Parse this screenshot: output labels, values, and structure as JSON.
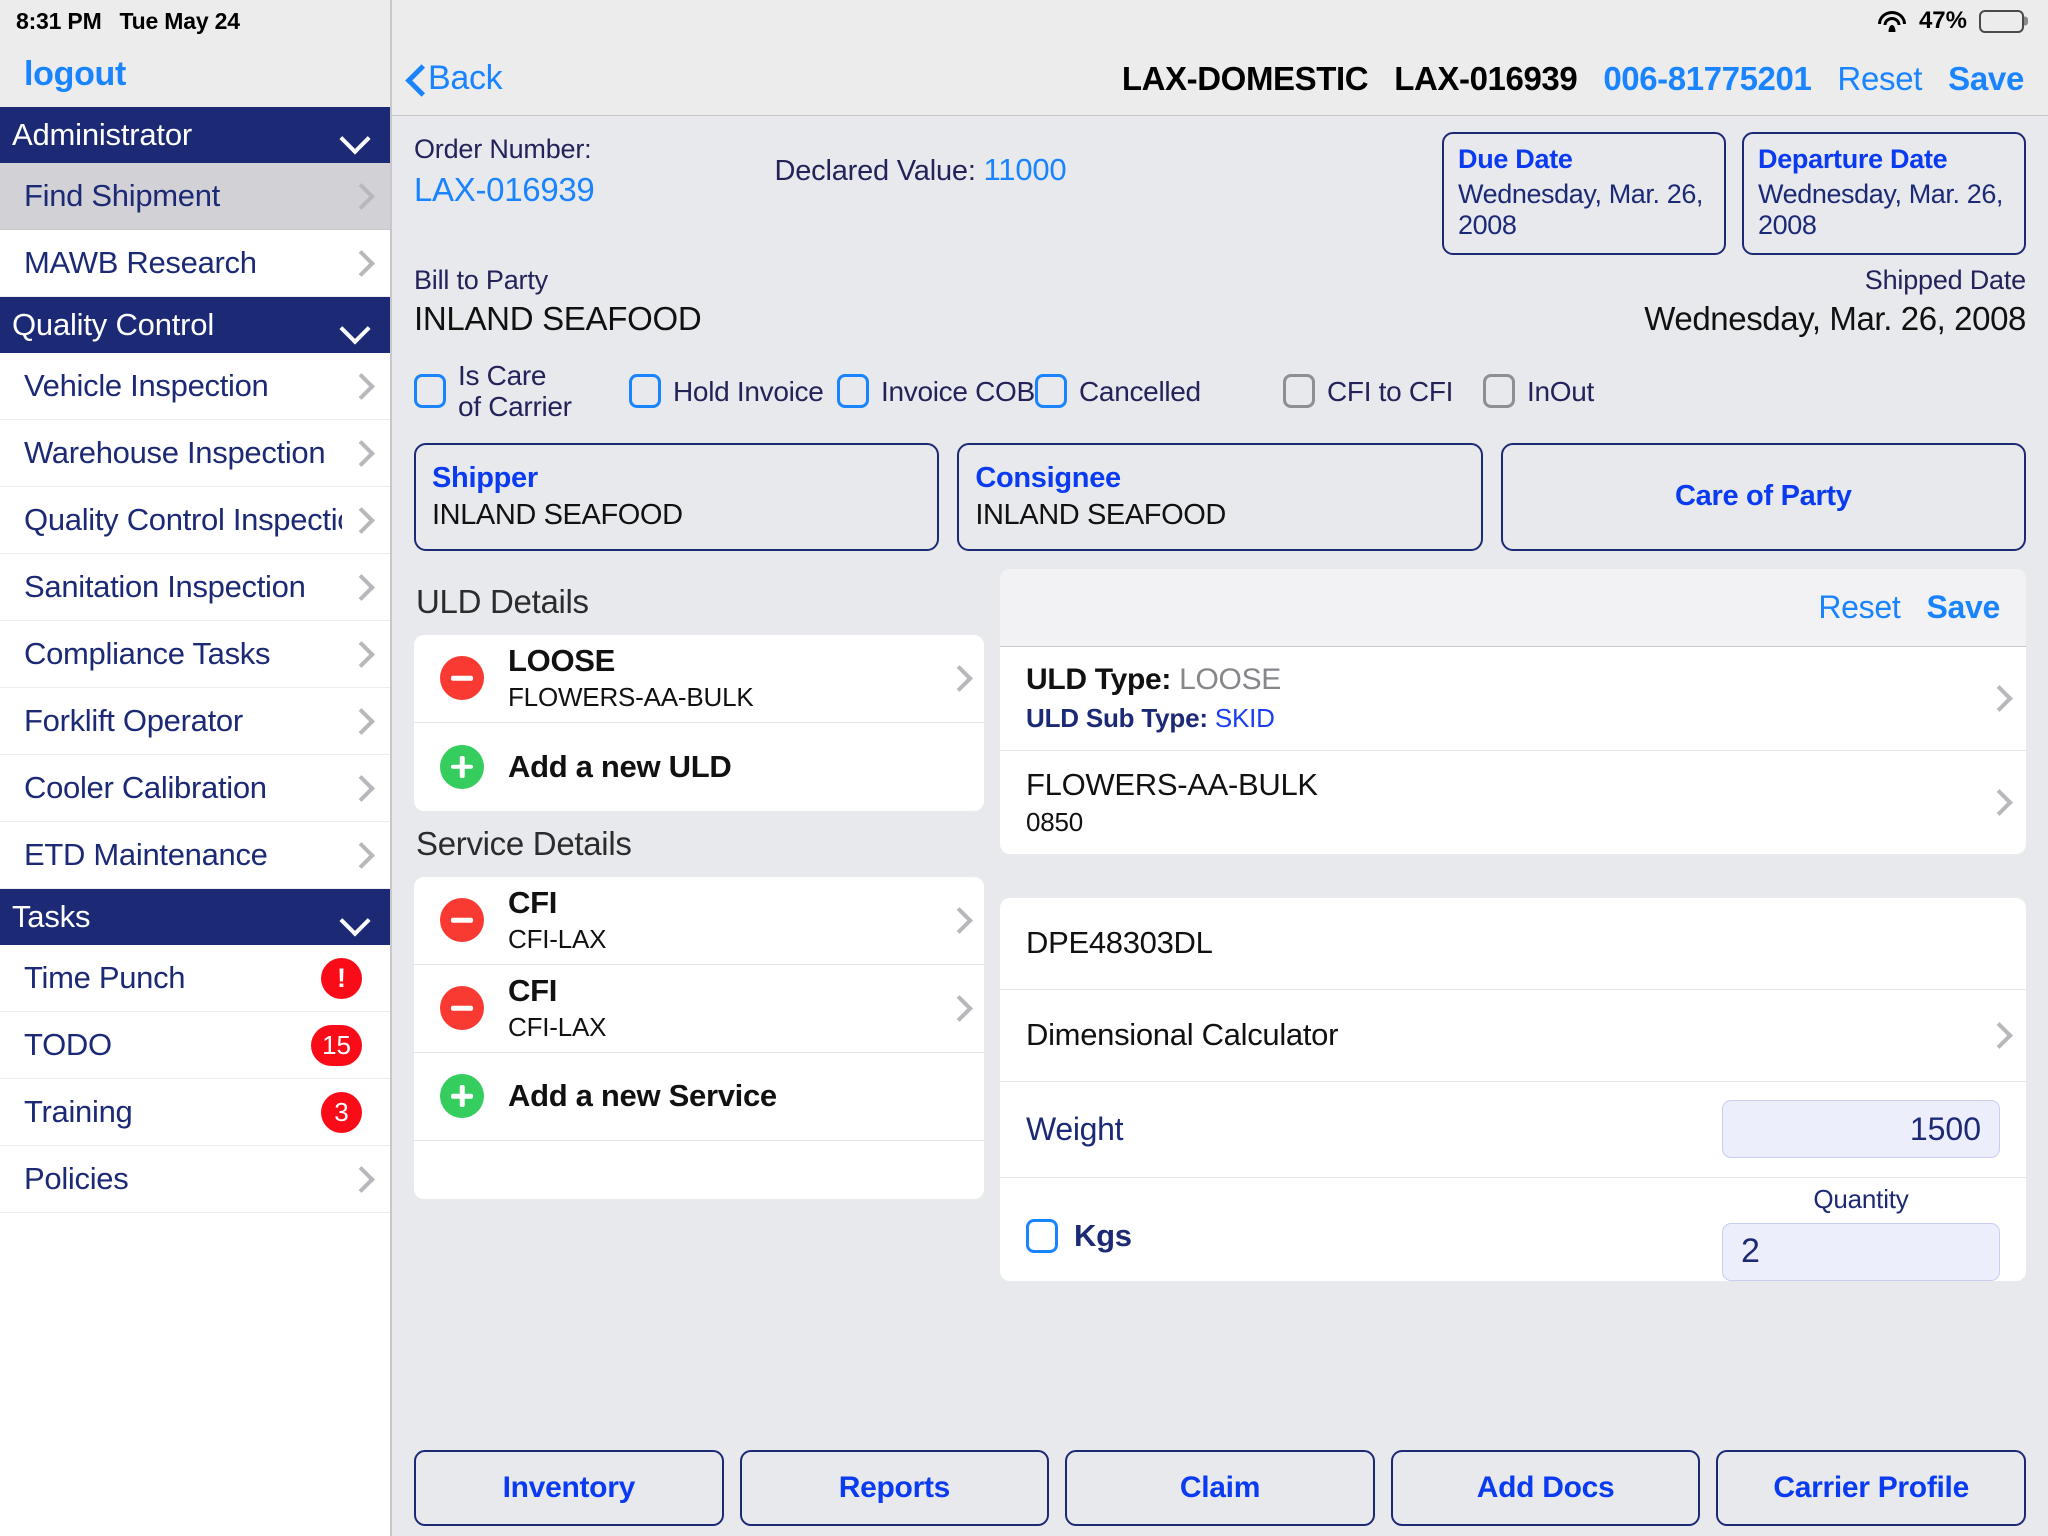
{
  "status_bar": {
    "time": "8:31 PM",
    "date": "Tue May 24",
    "battery_percent": "47%",
    "wifi_icon": "wifi-icon",
    "battery_icon": "battery-icon"
  },
  "sidebar": {
    "logout_label": "logout",
    "groups": [
      {
        "title": "Administrator",
        "items": [
          {
            "label": "Find Shipment",
            "selected": true,
            "badge": ""
          },
          {
            "label": "MAWB Research",
            "selected": false,
            "badge": ""
          }
        ]
      },
      {
        "title": "Quality Control",
        "items": [
          {
            "label": "Vehicle Inspection",
            "selected": false,
            "badge": ""
          },
          {
            "label": "Warehouse Inspection",
            "selected": false,
            "badge": ""
          },
          {
            "label": "Quality Control Inspection",
            "selected": false,
            "badge": ""
          },
          {
            "label": "Sanitation Inspection",
            "selected": false,
            "badge": ""
          },
          {
            "label": "Compliance Tasks",
            "selected": false,
            "badge": ""
          },
          {
            "label": "Forklift Operator",
            "selected": false,
            "badge": ""
          },
          {
            "label": "Cooler Calibration",
            "selected": false,
            "badge": ""
          },
          {
            "label": "ETD Maintenance",
            "selected": false,
            "badge": ""
          }
        ]
      },
      {
        "title": "Tasks",
        "items": [
          {
            "label": "Time Punch",
            "selected": false,
            "badge": "!"
          },
          {
            "label": "TODO",
            "selected": false,
            "badge": "15"
          },
          {
            "label": "Training",
            "selected": false,
            "badge": "3"
          },
          {
            "label": "Policies",
            "selected": false,
            "badge": ""
          }
        ]
      }
    ]
  },
  "navbar": {
    "back_label": "Back",
    "station": "LAX-DOMESTIC",
    "order_id": "LAX-016939",
    "awb": "006-81775201",
    "reset_label": "Reset",
    "save_label": "Save"
  },
  "order_info": {
    "order_number_label": "Order Number:",
    "order_number_value": "LAX-016939",
    "declared_value_label": "Declared Value:",
    "declared_value": "11000",
    "due_date_label": "Due Date",
    "due_date_value": "Wednesday, Mar. 26, 2008",
    "departure_date_label": "Departure Date",
    "departure_date_value": "Wednesday, Mar. 26, 2008",
    "bill_to_party_label": "Bill to Party",
    "bill_to_party_value": "INLAND SEAFOOD",
    "shipped_date_label": "Shipped Date",
    "shipped_date_value": "Wednesday, Mar. 26, 2008"
  },
  "checkboxes": [
    {
      "label": "Is Care\nof Carrier",
      "checked": false,
      "style": "blue"
    },
    {
      "label": "Hold Invoice",
      "checked": false,
      "style": "blue"
    },
    {
      "label": "Invoice COB",
      "checked": false,
      "style": "blue"
    },
    {
      "label": "Cancelled",
      "checked": false,
      "style": "blue"
    },
    {
      "label": "CFI to CFI",
      "checked": false,
      "style": "gray"
    },
    {
      "label": "InOut",
      "checked": false,
      "style": "gray"
    }
  ],
  "parties": {
    "shipper_label": "Shipper",
    "shipper_value": "INLAND SEAFOOD",
    "consignee_label": "Consignee",
    "consignee_value": "INLAND SEAFOOD",
    "care_of_party_label": "Care of Party"
  },
  "uld_details": {
    "section_title": "ULD Details",
    "rows": [
      {
        "title": "LOOSE",
        "subtitle": "FLOWERS-AA-BULK",
        "icon": "minus-circle-icon"
      }
    ],
    "add_label": "Add a new ULD"
  },
  "service_details": {
    "section_title": "Service Details",
    "rows": [
      {
        "title": "CFI",
        "subtitle": "CFI-LAX",
        "icon": "minus-circle-icon"
      },
      {
        "title": "CFI",
        "subtitle": "CFI-LAX",
        "icon": "minus-circle-icon"
      }
    ],
    "add_label": "Add a new Service"
  },
  "uld_panel": {
    "reset_label": "Reset",
    "save_label": "Save",
    "uld_type_label": "ULD Type:",
    "uld_type_value": "LOOSE",
    "uld_sub_type_label": "ULD Sub Type:",
    "uld_sub_type_value": "SKID",
    "commodity": "FLOWERS-AA-BULK",
    "commodity_code": "0850"
  },
  "detail_panel": {
    "dpe_code": "DPE48303DL",
    "dimensional_calculator_label": "Dimensional  Calculator",
    "weight_label": "Weight",
    "weight_value": "1500",
    "kgs_label": "Kgs",
    "kgs_checked": false,
    "quantity_label": "Quantity",
    "quantity_value": "2"
  },
  "bottom_toolbar": [
    {
      "label": "Inventory"
    },
    {
      "label": "Reports"
    },
    {
      "label": "Claim"
    },
    {
      "label": "Add Docs"
    },
    {
      "label": "Carrier Profile"
    }
  ],
  "colors": {
    "navy": "#1c2a76",
    "accent_blue": "#1a84ff",
    "link_blue": "#0b3bf0",
    "badge_red": "#fa0b18",
    "minus_red": "#f93a32",
    "plus_green": "#35cd5d"
  }
}
